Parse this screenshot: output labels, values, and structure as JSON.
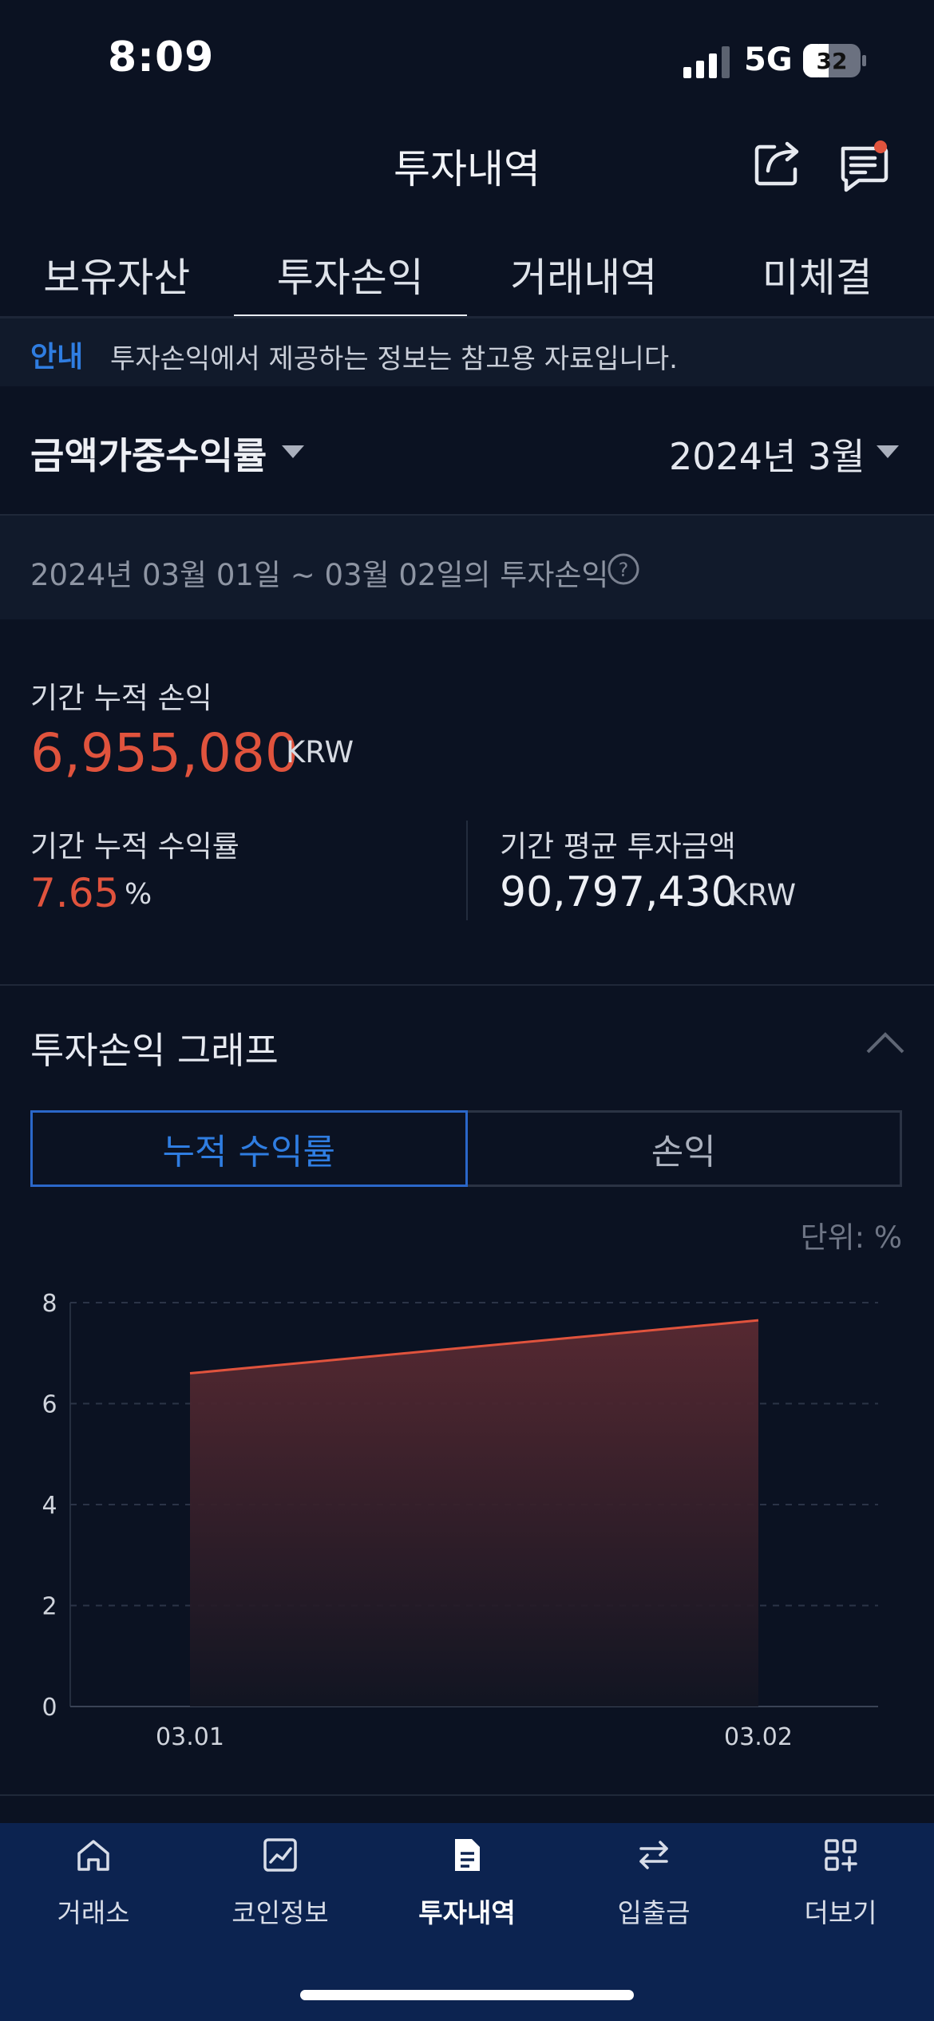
{
  "status_bar": {
    "time": "8:09",
    "network": "5G",
    "battery": "32"
  },
  "header": {
    "title": "투자내역",
    "icons": [
      "share-icon",
      "chat-notification-icon"
    ]
  },
  "tabs": [
    {
      "label": "보유자산",
      "active": false
    },
    {
      "label": "투자손익",
      "active": true
    },
    {
      "label": "거래내역",
      "active": false
    },
    {
      "label": "미체결",
      "active": false
    }
  ],
  "notice": {
    "tag": "안내",
    "text": "투자손익에서 제공하는 정보는 참고용 자료입니다."
  },
  "filters": {
    "metric": "금액가중수익률",
    "month": "2024년 3월"
  },
  "period": {
    "text": "2024년 03월 01일 ~ 03월 02일의 투자손익"
  },
  "summary": {
    "cumulative_pnl_label": "기간 누적 손익",
    "cumulative_pnl_value": "6,955,080",
    "cumulative_pnl_unit": "KRW",
    "cumulative_rate_label": "기간 누적 수익률",
    "cumulative_rate_value": "7.65",
    "cumulative_rate_unit": "%",
    "avg_invest_label": "기간 평균 투자금액",
    "avg_invest_value": "90,797,430",
    "avg_invest_unit": "KRW"
  },
  "graph": {
    "title": "투자손익 그래프",
    "toggle": {
      "active": "누적 수익률",
      "inactive": "손익"
    },
    "unit_label": "단위: %"
  },
  "chart_data": {
    "type": "area",
    "x": [
      "03.01",
      "03.02"
    ],
    "series": [
      {
        "values": [
          6.6,
          7.65
        ],
        "color": "#e0533d"
      }
    ],
    "ylim": [
      0,
      8
    ],
    "yticks": [
      0,
      2,
      4,
      6,
      8
    ],
    "grid": true
  },
  "bottom_nav": [
    {
      "label": "거래소",
      "icon": "home-icon",
      "active": false
    },
    {
      "label": "코인정보",
      "icon": "chart-icon",
      "active": false
    },
    {
      "label": "투자내역",
      "icon": "document-icon",
      "active": true
    },
    {
      "label": "입출금",
      "icon": "transfer-icon",
      "active": false
    },
    {
      "label": "더보기",
      "icon": "more-grid-icon",
      "active": false
    }
  ]
}
